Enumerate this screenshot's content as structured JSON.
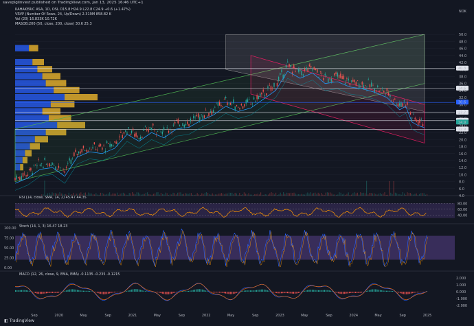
{
  "header": {
    "published": "saveplgiinvest published on TradingView.com, Jan 13, 2025 16:46 UTC+1"
  },
  "legends": {
    "main": [
      "KAHAKERIC ASA, 1D, OSL O15.8 H24.9 L22.8 C24.9 +0.6 (+1.47%)"
    ],
    "vrvp": "VRVP (Number Of Rows, 24, Up/Down) 2.319M 858.82 K",
    "vol": "Vol (20) 16.833K 10.72K",
    "ma": "MASOB:200 (50, close, 200, close) 30.6 25.3",
    "rsi": "RSI (14, close, SMA, 14, 2) 45.47 44.35",
    "stoch": "Stoch (14, 1, 3) 16.47 18.23",
    "macd": "MACD (12, 26, close, 9, EMA, EMA) -0.1135 -0.235 -0.1215"
  },
  "price_axis": {
    "labels": [
      "50.0",
      "48.0",
      "46.0",
      "44.0",
      "42.0",
      "40.0",
      "38.0",
      "36.0",
      "34.0",
      "32.0",
      "30.0",
      "28.0",
      "26.0",
      "24.0",
      "22.0",
      "20.0",
      "18.0",
      "16.0",
      "14.0",
      "12.0",
      "10.0",
      "8.0",
      "6.0",
      "4.0"
    ],
    "currency": "NOK",
    "badges": [
      {
        "text": "40.3",
        "price": 40.3,
        "color": "#e0e3eb"
      },
      {
        "text": "34.6",
        "price": 34.6,
        "color": "#e0e3eb"
      },
      {
        "text": "30.6",
        "price": 30.6,
        "color": "#2962ff"
      },
      {
        "text": "27.7",
        "price": 27.7,
        "color": "#e0e3eb"
      },
      {
        "text": "25.4",
        "price": 25.4,
        "color": "#e0e3eb"
      },
      {
        "text": "24.9",
        "price": 24.9,
        "color": "#26a69a"
      },
      {
        "text": "22.9",
        "price": 22.9,
        "color": "#e0e3eb"
      }
    ],
    "nok_badge": "NOK"
  },
  "rsi_axis": [
    "80.00",
    "60.00",
    "40.00"
  ],
  "stoch_axis": [
    "100.00",
    "75.00",
    "50.00",
    "25.00",
    "0.00"
  ],
  "macd_axis": [
    "2.000",
    "1.000",
    "0.000",
    "-1.000",
    "-2.000"
  ],
  "time_axis": [
    "Sep",
    "2020",
    "May",
    "Sep",
    "2021",
    "May",
    "Sep",
    "2022",
    "May",
    "Sep",
    "2023",
    "May",
    "Sep",
    "2024",
    "May",
    "Sep",
    "2025"
  ],
  "logo_text": "TradingView",
  "colors": {
    "bg": "#131722",
    "grid": "#1f2330",
    "up": "#26a69a",
    "down": "#ef5350",
    "channel_green": "#4caf50",
    "channel_pink": "#e91e63",
    "rsi": "#ff9800",
    "stoch_k": "#2962ff",
    "stoch_d": "#ff9800",
    "macd": "#2962ff",
    "signal": "#ff6d00",
    "vp_blue": "#2962ff",
    "vp_yellow": "#fbc02d",
    "ma_blue": "#2196f3"
  },
  "chart_data": {
    "type": "line",
    "title": "KAHAKERIC ASA, 1D, OSL",
    "ylabel": "NOK",
    "ylim": [
      4,
      52
    ],
    "x_range": [
      "2019-07",
      "2025-01"
    ],
    "price_path": [
      [
        "2019-07",
        9.0
      ],
      [
        "2019-09",
        10.5
      ],
      [
        "2019-11",
        13.0
      ],
      [
        "2020-01",
        13.5
      ],
      [
        "2020-03",
        11.0
      ],
      [
        "2020-05",
        16.5
      ],
      [
        "2020-07",
        18.0
      ],
      [
        "2020-09",
        17.5
      ],
      [
        "2020-11",
        19.0
      ],
      [
        "2021-01",
        23.0
      ],
      [
        "2021-03",
        21.0
      ],
      [
        "2021-05",
        23.5
      ],
      [
        "2021-07",
        22.0
      ],
      [
        "2021-09",
        24.5
      ],
      [
        "2021-11",
        25.0
      ],
      [
        "2022-01",
        27.0
      ],
      [
        "2022-03",
        28.5
      ],
      [
        "2022-05",
        31.0
      ],
      [
        "2022-07",
        29.5
      ],
      [
        "2022-09",
        30.5
      ],
      [
        "2022-11",
        33.0
      ],
      [
        "2023-01",
        35.5
      ],
      [
        "2023-03",
        41.0
      ],
      [
        "2023-05",
        39.0
      ],
      [
        "2023-07",
        40.5
      ],
      [
        "2023-09",
        37.5
      ],
      [
        "2023-11",
        38.0
      ],
      [
        "2024-01",
        36.5
      ],
      [
        "2024-03",
        36.0
      ],
      [
        "2024-05",
        35.0
      ],
      [
        "2024-07",
        33.5
      ],
      [
        "2024-09",
        30.0
      ],
      [
        "2024-10",
        31.0
      ],
      [
        "2024-11",
        26.5
      ],
      [
        "2024-12",
        25.5
      ],
      [
        "2025-01",
        24.9
      ]
    ],
    "horizontal_levels": [
      40.3,
      34.6,
      30.6,
      27.7,
      25.4,
      22.9
    ],
    "rsi": {
      "name": "RSI",
      "last": 45.47,
      "signal": 44.35,
      "range": [
        20,
        90
      ]
    },
    "stoch": {
      "k": 16.47,
      "d": 18.23,
      "range": [
        0,
        100
      ]
    },
    "macd": {
      "macd": -0.1135,
      "signal": -0.235,
      "hist": -0.1215,
      "range": [
        -2.5,
        2.5
      ]
    }
  }
}
